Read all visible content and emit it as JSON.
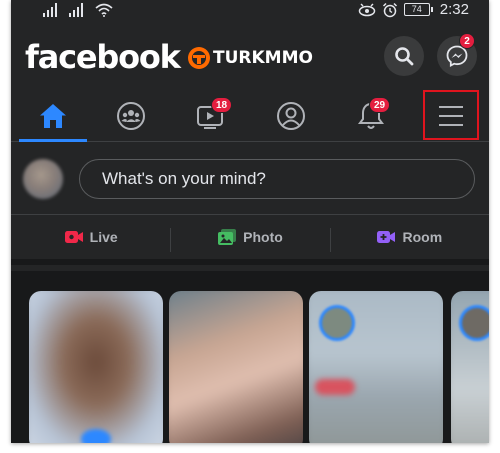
{
  "status_bar": {
    "time": "2:32",
    "battery": "74"
  },
  "header": {
    "logo": "facebook",
    "brand_text": "TURKMMO",
    "messenger_badge": "2"
  },
  "tabs": [
    {
      "name": "home",
      "badge": ""
    },
    {
      "name": "groups",
      "badge": ""
    },
    {
      "name": "watch",
      "badge": "18"
    },
    {
      "name": "profile",
      "badge": ""
    },
    {
      "name": "notifications",
      "badge": "29"
    },
    {
      "name": "menu",
      "badge": ""
    }
  ],
  "composer": {
    "placeholder": "What's on your mind?"
  },
  "actions": {
    "live": "Live",
    "photo": "Photo",
    "room": "Room"
  },
  "colors": {
    "background": "#242526",
    "accent": "#2d88ff",
    "badge": "#e41e3f",
    "highlight": "#e0141e",
    "live": "#f02849",
    "photo": "#45bd62",
    "room": "#9360f7"
  }
}
